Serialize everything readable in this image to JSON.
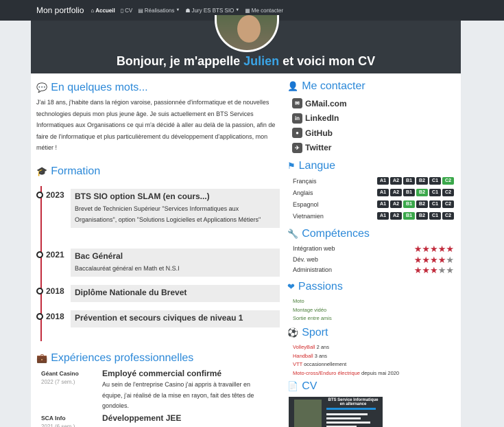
{
  "nav": {
    "brand": "Mon portfolio",
    "items": [
      {
        "label": "Accueil",
        "icon": "home-icon",
        "glyph": "⌂",
        "active": true
      },
      {
        "label": "CV",
        "icon": "file-icon",
        "glyph": "▯",
        "dropdown": false
      },
      {
        "label": "Réalisations",
        "icon": "list-icon",
        "glyph": "▤",
        "dropdown": true
      },
      {
        "label": "Jury ES BTS SIO",
        "icon": "grad-cap-icon",
        "glyph": "☗",
        "dropdown": true
      },
      {
        "label": "Me contacter",
        "icon": "card-icon",
        "glyph": "▦",
        "dropdown": false
      }
    ]
  },
  "hero": {
    "pre": "Bonjour, je m'appelle ",
    "name": "Julien",
    "post": " et voici mon CV"
  },
  "about": {
    "title": "En quelques mots...",
    "text": "J'ai 18 ans, j'habite dans la région varoise, passionnée d'informatique et de nouvelles technologies depuis mon plus jeune âge. Je suis actuellement en BTS Services Informatiques aux Organisations ce qui m'a décidé à aller au delà de la passion, afin de faire de l'informatique et plus particulièrement du développement d'applications, mon métier !"
  },
  "formation": {
    "title": "Formation",
    "items": [
      {
        "year": "2023",
        "title": "BTS SIO option SLAM (en cours...)",
        "desc": "Brevet de Technicien Supérieur \"Services Informatiques aux Organisations\", option \"Solutions Logicielles et Applications Métiers\""
      },
      {
        "year": "2021",
        "title": "Bac Général",
        "desc": "Baccalauréat général en Math et N.S.I"
      },
      {
        "year": "2018",
        "title": "Diplôme Nationale du Brevet",
        "desc": ""
      },
      {
        "year": "2018",
        "title": "Prévention et secours civiques de niveau 1",
        "desc": ""
      }
    ]
  },
  "experiences": {
    "title": "Expériences professionnelles",
    "items": [
      {
        "company": "Géant Casino",
        "duration": "2022 (7 sem.)",
        "title": "Employé commercial confirmé",
        "desc": "Au sein de l'entreprise Casino j'ai appris à travailler en équipe, j'ai réalisé de la mise en rayon, fait des têtes de gondoles."
      },
      {
        "company": "SCA Info",
        "duration": "2021 (6 sem.)",
        "title": "Développement JEE",
        "desc": ""
      }
    ]
  },
  "contact": {
    "title": "Me contacter",
    "items": [
      {
        "label": "GMail.com",
        "icon": "mail-icon",
        "glyph": "✉"
      },
      {
        "label": "LinkedIn",
        "icon": "linkedin-icon",
        "glyph": "in"
      },
      {
        "label": "GitHub",
        "icon": "github-icon",
        "glyph": "●"
      },
      {
        "label": "Twitter",
        "icon": "twitter-icon",
        "glyph": "✈"
      }
    ]
  },
  "langue": {
    "title": "Langue",
    "levels": [
      "A1",
      "A2",
      "B1",
      "B2",
      "C1",
      "C2"
    ],
    "items": [
      {
        "label": "Français",
        "highlight": 5
      },
      {
        "label": "Anglais",
        "highlight": 3
      },
      {
        "label": "Espagnol",
        "highlight": 2
      },
      {
        "label": "Vietnamien",
        "highlight": 2
      }
    ]
  },
  "competences": {
    "title": "Compétences",
    "items": [
      {
        "label": "Intégration web",
        "stars": 5
      },
      {
        "label": "Dév. web",
        "stars": 4
      },
      {
        "label": "Administration",
        "stars": 3
      }
    ]
  },
  "passions": {
    "title": "Passions",
    "items": [
      "Moto",
      "Montage vidéo",
      "Sortie entre amis"
    ]
  },
  "sport": {
    "title": "Sport",
    "items": [
      {
        "name": "VolleyBall",
        "detail": " 2 ans",
        "color": "red"
      },
      {
        "name": "Handball",
        "detail": " 3 ans",
        "color": "red"
      },
      {
        "name": "VTT",
        "detail": " occasionnellement",
        "color": "red"
      },
      {
        "name": "Moto-cross/Enduro électrique",
        "detail": " depuis mai 2020",
        "color": "red"
      }
    ]
  },
  "cv": {
    "title": "CV",
    "thumb_title": "BTS Service Informatique",
    "thumb_sub": "en alternance"
  },
  "colors": {
    "accent": "#2b88d8",
    "navbar": "#2b3036",
    "timeline": "#c12b3c",
    "level_on": "#3ba84b"
  }
}
